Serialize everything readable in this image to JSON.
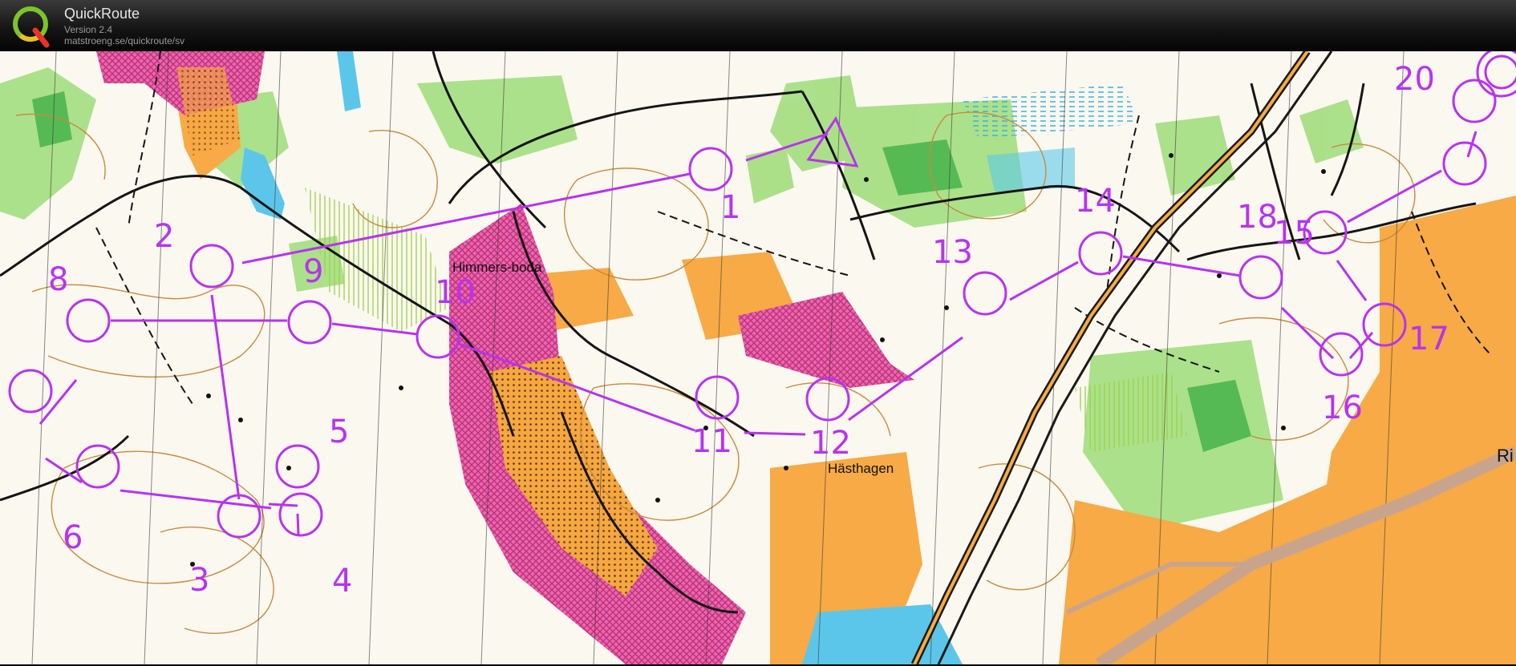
{
  "app": {
    "title": "QuickRoute",
    "version": "Version 2.4",
    "url": "matstroeng.se/quickroute/sv"
  },
  "logo": {
    "letter": "Q",
    "icon": "quickroute-logo-icon"
  },
  "colors": {
    "course": "#b833ee",
    "forest_green": "#8fd56b",
    "open_yellow": "#f7b23f",
    "forbidden_pink": "#e0559b",
    "water_blue": "#4fc4e8",
    "contour_brown": "#c98a3c",
    "header_bg": "#1a1a1a"
  },
  "map": {
    "place_names": [
      "Himmers-boda",
      "Hästhagen",
      "Ri"
    ],
    "start_symbol": "start-triangle",
    "finish_symbol": "finish-double-circle",
    "controls": [
      "1",
      "2",
      "3",
      "4",
      "5",
      "6",
      "8",
      "9",
      "10",
      "11",
      "12",
      "13",
      "14",
      "15",
      "16",
      "17",
      "18",
      "20"
    ]
  }
}
